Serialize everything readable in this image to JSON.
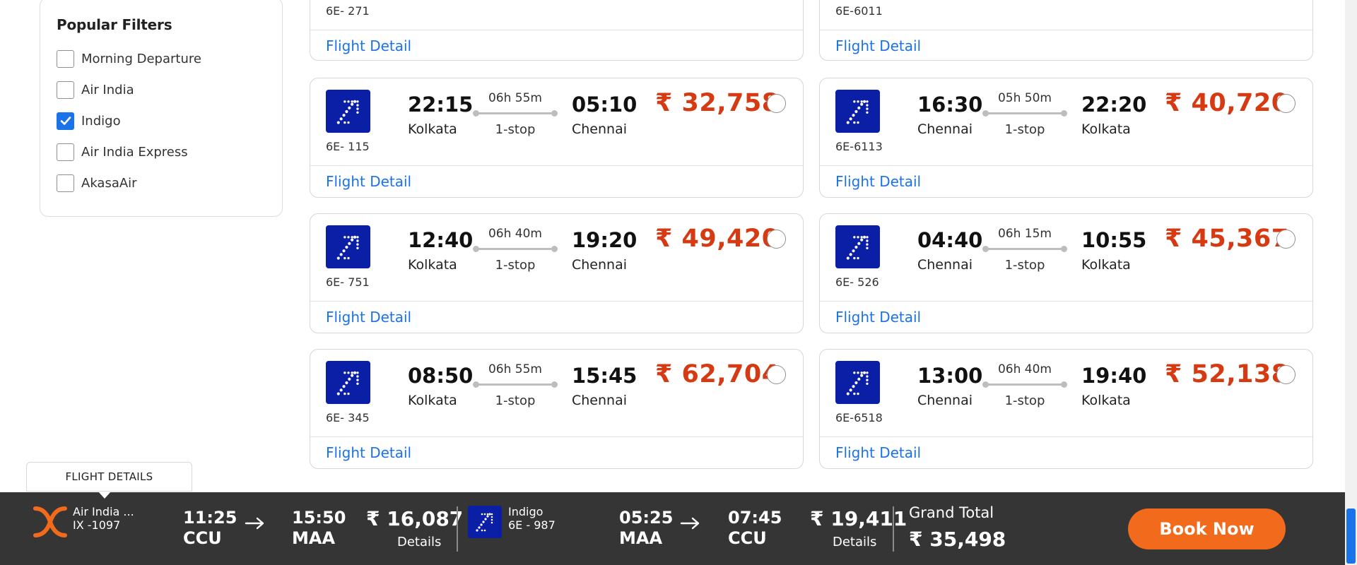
{
  "filters": {
    "title": "Popular Filters",
    "items": [
      {
        "label": "Morning Departure",
        "checked": false
      },
      {
        "label": "Air India",
        "checked": false
      },
      {
        "label": "Indigo",
        "checked": true
      },
      {
        "label": "Air India Express",
        "checked": false
      },
      {
        "label": "AkasaAir",
        "checked": false
      }
    ]
  },
  "top_partial": {
    "left_code": "6E- 271",
    "right_code": "6E-6011",
    "link": "Flight Detail"
  },
  "flights": [
    {
      "code": "6E- 115",
      "dep_time": "22:15",
      "dep_city": "Kolkata",
      "duration": "06h 55m",
      "stops": "1-stop",
      "arr_time": "05:10",
      "arr_city": "Chennai",
      "price": "₹ 32,758",
      "link": "Flight Detail"
    },
    {
      "code": "6E-6113",
      "dep_time": "16:30",
      "dep_city": "Chennai",
      "duration": "05h 50m",
      "stops": "1-stop",
      "arr_time": "22:20",
      "arr_city": "Kolkata",
      "price": "₹ 40,720",
      "link": "Flight Detail"
    },
    {
      "code": "6E- 751",
      "dep_time": "12:40",
      "dep_city": "Kolkata",
      "duration": "06h 40m",
      "stops": "1-stop",
      "arr_time": "19:20",
      "arr_city": "Chennai",
      "price": "₹ 49,420",
      "link": "Flight Detail"
    },
    {
      "code": "6E- 526",
      "dep_time": "04:40",
      "dep_city": "Chennai",
      "duration": "06h 15m",
      "stops": "1-stop",
      "arr_time": "10:55",
      "arr_city": "Kolkata",
      "price": "₹ 45,367",
      "link": "Flight Detail"
    },
    {
      "code": "6E- 345",
      "dep_time": "08:50",
      "dep_city": "Kolkata",
      "duration": "06h 55m",
      "stops": "1-stop",
      "arr_time": "15:45",
      "arr_city": "Chennai",
      "price": "₹ 62,704",
      "link": "Flight Detail"
    },
    {
      "code": "6E-6518",
      "dep_time": "13:00",
      "dep_city": "Chennai",
      "duration": "06h 40m",
      "stops": "1-stop",
      "arr_time": "19:40",
      "arr_city": "Kolkata",
      "price": "₹ 52,138",
      "link": "Flight Detail"
    }
  ],
  "bottom_bar": {
    "tooltip": "FLIGHT DETAILS",
    "outbound": {
      "airline": "Air India ...",
      "code": "IX -1097",
      "dep_time": "11:25",
      "dep_code": "CCU",
      "arr_time": "15:50",
      "arr_code": "MAA",
      "price": "₹ 16,087",
      "details": "Details"
    },
    "return": {
      "airline": "Indigo",
      "code": "6E - 987",
      "dep_time": "05:25",
      "dep_code": "MAA",
      "arr_time": "07:45",
      "arr_code": "CCU",
      "price": "₹ 19,411",
      "details": "Details"
    },
    "grand_total_label": "Grand Total",
    "grand_total": "₹ 35,498",
    "book_label": "Book Now"
  },
  "colors": {
    "price": "#d63a12",
    "link": "#1a73e8",
    "book": "#f26a1c",
    "bar": "#353535",
    "indigo_logo": "#0b1ea6"
  }
}
